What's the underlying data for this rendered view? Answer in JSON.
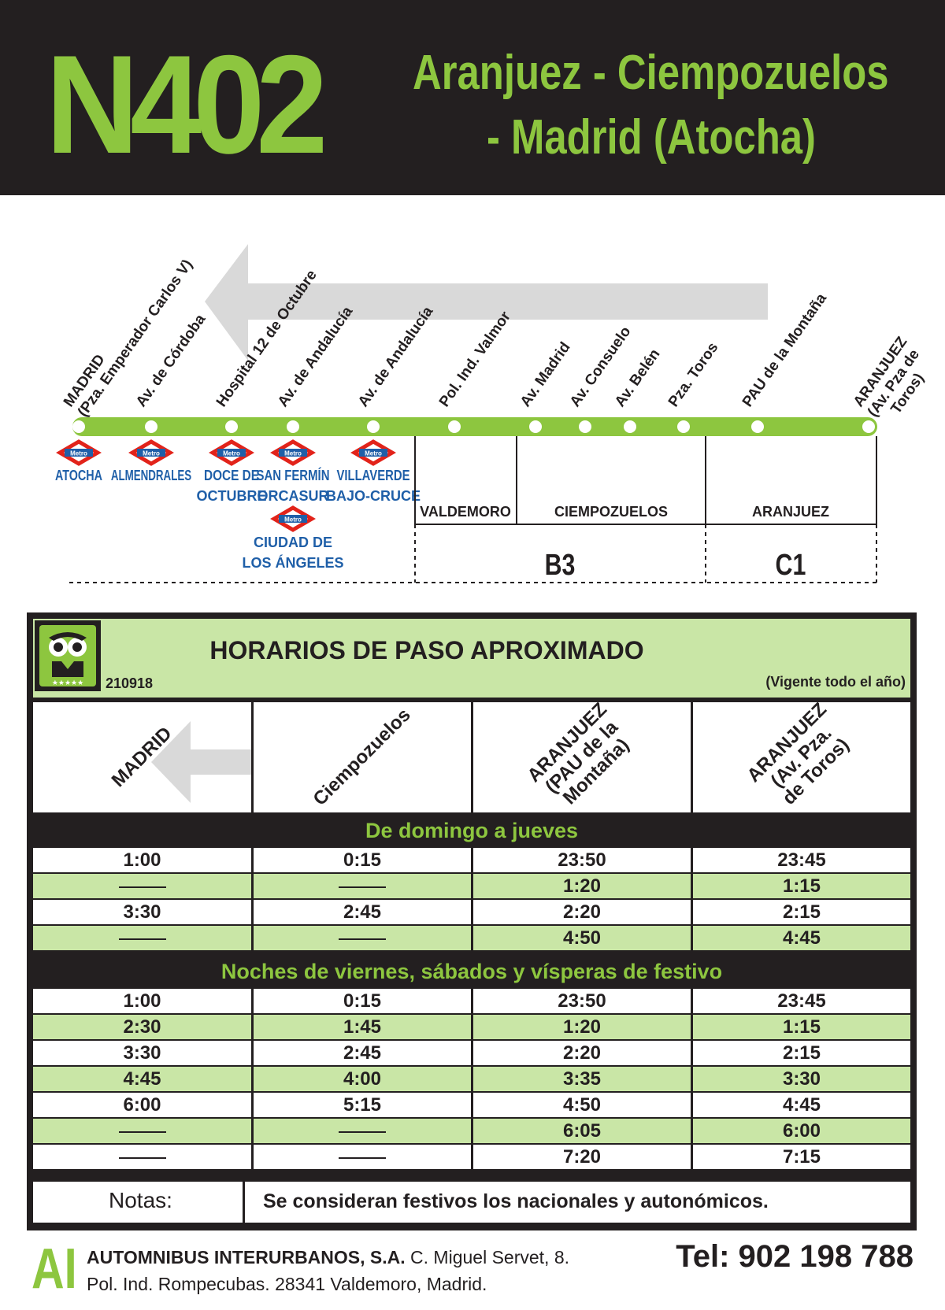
{
  "header": {
    "route_code": "N402",
    "route_name_line1": "Aranjuez - Ciempozuelos",
    "route_name_line2": "- Madrid (Atocha)"
  },
  "map": {
    "stops": [
      {
        "name": "MADRID",
        "sub": "(Pza. Emperador Carlos V)"
      },
      {
        "name": "Av. de Córdoba",
        "sub": ""
      },
      {
        "name": "Hospital 12 de Octubre",
        "sub": ""
      },
      {
        "name": "Av. de Andalucía",
        "sub": ""
      },
      {
        "name": "Av. de Andalucía",
        "sub": ""
      },
      {
        "name": "Pol. Ind. Valmor",
        "sub": ""
      },
      {
        "name": "Av. Madrid",
        "sub": ""
      },
      {
        "name": "Av. Consuelo",
        "sub": ""
      },
      {
        "name": "Av. Belén",
        "sub": ""
      },
      {
        "name": "Pza. Toros",
        "sub": ""
      },
      {
        "name": "PAU de la Montaña",
        "sub": ""
      },
      {
        "name": "ARANJUEZ",
        "sub": "(Av. Pza de",
        "sub2": "Toros)"
      }
    ],
    "metro_label": "Metro",
    "metro_stations": [
      {
        "line1": "ATOCHA",
        "line2": ""
      },
      {
        "line1": "ALMENDRALES",
        "line2": ""
      },
      {
        "line1": "DOCE DE",
        "line2": "OCTUBRE"
      },
      {
        "line1": "SAN FERMÍN",
        "line2": "ORCASUR"
      },
      {
        "line1": "VILLAVERDE",
        "line2": "BAJO-CRUCE"
      }
    ],
    "extra_metro": {
      "line1": "CIUDAD DE",
      "line2": "LOS ÁNGELES"
    },
    "towns": [
      "VALDEMORO",
      "CIEMPOZUELOS",
      "ARANJUEZ"
    ],
    "zones": [
      "B3",
      "C1"
    ],
    "colors": {
      "line": "#8dc63f",
      "metro_red": "#e2231a",
      "metro_blue": "#1f5fa8",
      "arrow": "#d9d9d9"
    }
  },
  "timetable": {
    "title": "HORARIOS DE PASO APROXIMADO",
    "code": "210918",
    "validity": "(Vigente todo el año)",
    "columns": [
      {
        "line1": "MADRID",
        "line2": "",
        "line3": ""
      },
      {
        "line1": "Ciempozuelos",
        "line2": "",
        "line3": ""
      },
      {
        "line1": "ARANJUEZ",
        "line2": "(PAU de la",
        "line3": "Montaña)"
      },
      {
        "line1": "ARANJUEZ",
        "line2": "(Av. Pza.",
        "line3": "de Toros)"
      }
    ],
    "section1": {
      "title": "De domingo a jueves",
      "rows": [
        [
          "1:00",
          "0:15",
          "23:50",
          "23:45"
        ],
        [
          "—",
          "—",
          "1:20",
          "1:15"
        ],
        [
          "3:30",
          "2:45",
          "2:20",
          "2:15"
        ],
        [
          "—",
          "—",
          "4:50",
          "4:45"
        ]
      ]
    },
    "section2": {
      "title": "Noches de viernes, sábados y vísperas de festivo",
      "rows": [
        [
          "1:00",
          "0:15",
          "23:50",
          "23:45"
        ],
        [
          "2:30",
          "1:45",
          "1:20",
          "1:15"
        ],
        [
          "3:30",
          "2:45",
          "2:20",
          "2:15"
        ],
        [
          "4:45",
          "4:00",
          "3:35",
          "3:30"
        ],
        [
          "6:00",
          "5:15",
          "4:50",
          "4:45"
        ],
        [
          "—",
          "—",
          "6:05",
          "6:00"
        ],
        [
          "—",
          "—",
          "7:20",
          "7:15"
        ]
      ]
    },
    "notes_label": "Notas:",
    "notes_text": "Se consideran festivos los nacionales y autonómicos."
  },
  "footer": {
    "logo": "AI",
    "company": "AUTOMNIBUS INTERURBANOS, S.A.",
    "street": "C. Miguel Servet, 8.",
    "address": "Pol. Ind. Rompecubas. 28341 Valdemoro, Madrid.",
    "phone": "Tel: 902 198 788"
  }
}
